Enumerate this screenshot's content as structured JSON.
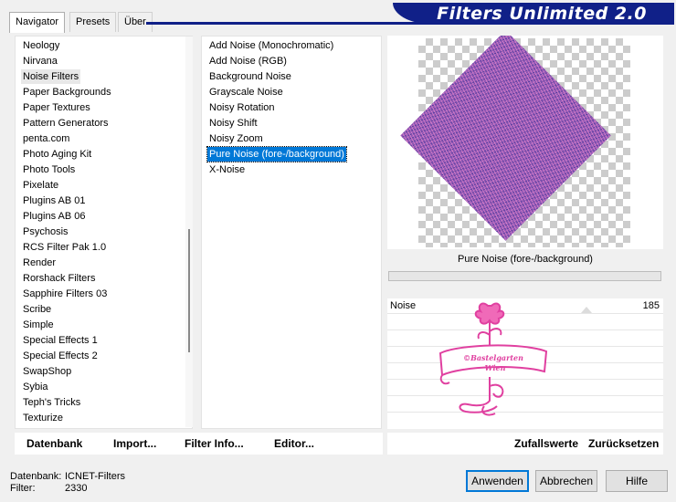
{
  "tabs": [
    "Navigator",
    "Presets",
    "Über"
  ],
  "app_title": "Filters Unlimited 2.0",
  "categories": {
    "items": [
      "Neology",
      "Nirvana",
      "Noise Filters",
      "Paper Backgrounds",
      "Paper Textures",
      "Pattern Generators",
      "penta.com",
      "Photo Aging Kit",
      "Photo Tools",
      "Pixelate",
      "Plugins AB 01",
      "Plugins AB 06",
      "Psychosis",
      "RCS Filter Pak 1.0",
      "Render",
      "Rorshack Filters",
      "Sapphire Filters 03",
      "Scribe",
      "Simple",
      "Special Effects 1",
      "Special Effects 2",
      "SwapShop",
      "Sybia",
      "Teph's Tricks",
      "Texturize"
    ],
    "selected": "Noise Filters",
    "scroll_position": 0.72
  },
  "filters": {
    "items": [
      "Add Noise (Monochromatic)",
      "Add Noise (RGB)",
      "Background Noise",
      "Grayscale Noise",
      "Noisy Rotation",
      "Noisy Shift",
      "Noisy Zoom",
      "Pure Noise (fore-/background)",
      "X-Noise"
    ],
    "selected": "Pure Noise (fore-/background)"
  },
  "preview": {
    "effect_name": "Pure Noise (fore-/background)"
  },
  "params": [
    {
      "label": "Noise",
      "value": "185"
    }
  ],
  "watermark": {
    "line1": "©Bastelgarten",
    "line2": "Wien"
  },
  "bottom_buttons_left": [
    "Datenbank",
    "Import...",
    "Filter Info...",
    "Editor..."
  ],
  "bottom_buttons_right": [
    "Zufallswerte",
    "Zurücksetzen"
  ],
  "status": {
    "db_label": "Datenbank:",
    "db_value": "ICNET-Filters",
    "filter_label": "Filter:",
    "filter_value": "2330"
  },
  "dialog_buttons": {
    "ok": "Anwenden",
    "cancel": "Abbrechen",
    "help": "Hilfe"
  },
  "colors": {
    "selection": "#0078d7",
    "title_banner": "#102088",
    "watermark": "#e040a0"
  }
}
